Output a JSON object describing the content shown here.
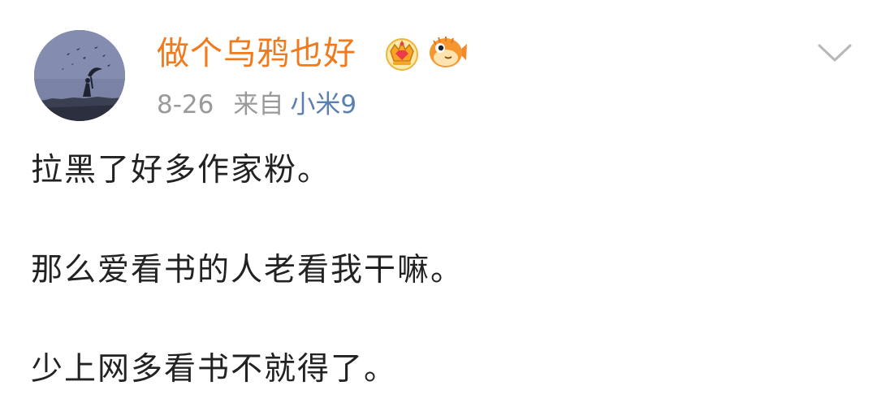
{
  "post": {
    "author": {
      "name": "做个乌鸦也好",
      "avatar": "avatar-image",
      "badges": [
        "crown-badge-icon",
        "pufferfish-badge-icon"
      ]
    },
    "meta": {
      "date": "8-26",
      "from_label": "来自",
      "device": "小米9"
    },
    "menu_icon": "chevron-down-icon",
    "content": {
      "lines": [
        "拉黑了好多作家粉。",
        "那么爱看书的人老看我干嘛。",
        "少上网多看书不就得了。"
      ]
    }
  },
  "colors": {
    "username": "#f07a1c",
    "device_link": "#5b7fb0",
    "meta_gray": "#9a9a9a",
    "body_text": "#222222"
  }
}
